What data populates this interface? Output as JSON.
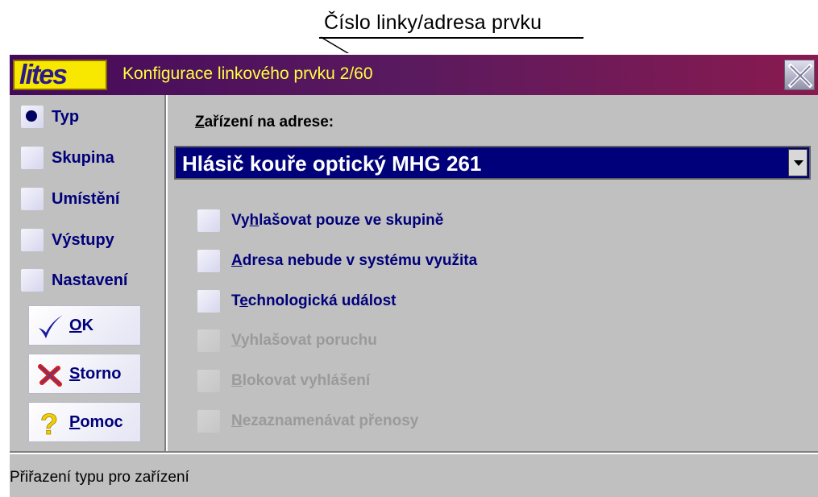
{
  "callout": {
    "text": "Číslo linky/adresa prvku"
  },
  "window": {
    "logo": "lites",
    "title": "Konfigurace linkového prvku 2/60",
    "close_icon": "close-icon"
  },
  "nav": {
    "items": [
      {
        "label": "Typ",
        "selected": true
      },
      {
        "label": "Skupina",
        "selected": false
      },
      {
        "label": "Umístění",
        "selected": false
      },
      {
        "label": "Výstupy",
        "selected": false
      },
      {
        "label": "Nastavení",
        "selected": false
      }
    ]
  },
  "buttons": {
    "ok": {
      "label_u": "O",
      "label_rest": "K",
      "icon": "checkmark-icon"
    },
    "cancel": {
      "label_u": "S",
      "label_rest": "torno",
      "icon": "cross-icon"
    },
    "help": {
      "label_u": "P",
      "label_rest": "omoc",
      "icon": "question-icon"
    }
  },
  "device": {
    "label_u": "Z",
    "label_rest": "ařízení na adrese:",
    "selected_value": "Hlásič kouře optický MHG 261"
  },
  "options": [
    {
      "pre": "Vy",
      "u": "h",
      "post": "lašovat pouze ve skupině",
      "enabled": true
    },
    {
      "pre": "",
      "u": "A",
      "post": "dresa nebude v systému využita",
      "enabled": true
    },
    {
      "pre": "T",
      "u": "e",
      "post": "chnologická událost",
      "enabled": true
    },
    {
      "pre": "",
      "u": "V",
      "post": "yhlašovat poruchu",
      "enabled": false
    },
    {
      "pre": "",
      "u": "B",
      "post": "lokovat vyhlášení",
      "enabled": false
    },
    {
      "pre": "",
      "u": "N",
      "post": "ezaznamenávat přenosy",
      "enabled": false
    }
  ],
  "status": {
    "text": "Přiřazení typu pro zařízení"
  },
  "colors": {
    "accent": "#00007a",
    "title_text": "#ffff40",
    "disabled": "#9a9a9a"
  }
}
